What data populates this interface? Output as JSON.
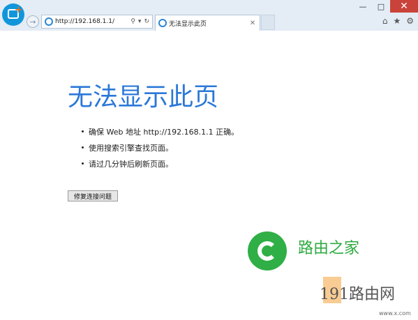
{
  "window": {
    "minimize_glyph": "—",
    "maximize_glyph": "□",
    "close_glyph": "✕"
  },
  "toolbar": {
    "app_logo_icon": "app-logo-icon",
    "back_glyph": "→",
    "address": "http://192.168.1.1/",
    "search_glyph": "⚲",
    "dropdown_glyph": "▾",
    "refresh_glyph": "↻",
    "tab_title": "无法显示此页",
    "tab_close_glyph": "✕",
    "home_glyph": "⌂",
    "favorites_glyph": "★",
    "settings_glyph": "⚙"
  },
  "page": {
    "heading": "无法显示此页",
    "bullets": [
      "确保 Web 地址 http://192.168.1.1 正确。",
      "使用搜索引擎查找页面。",
      "请过几分钟后刷新页面。"
    ],
    "fix_button": "修复连接问题"
  },
  "watermark": {
    "title": "路由之家",
    "line2": "191路由网",
    "small": "www.x.com"
  },
  "colors": {
    "accent": "#2b78d8",
    "chrome_bg": "#e4ecf5",
    "close_bg": "#c9433a",
    "watermark_green": "#2faf45"
  }
}
